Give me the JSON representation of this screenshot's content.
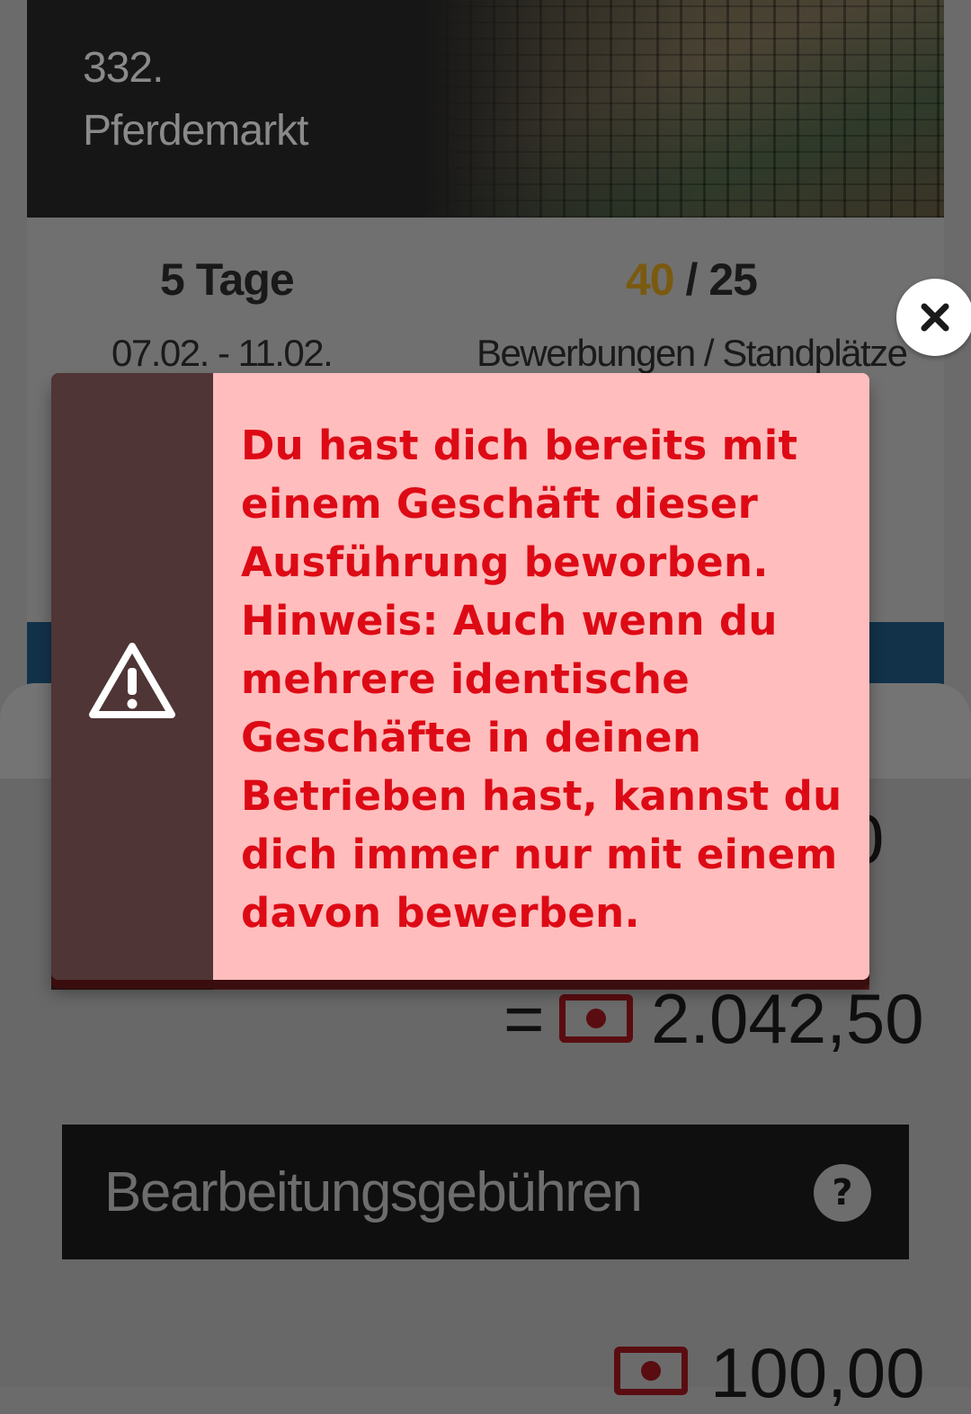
{
  "event": {
    "number": "332.",
    "name": "Pferdemarkt"
  },
  "stats": {
    "duration": "5 Tage",
    "dates": "07.02. - 11.02.",
    "applications": "40",
    "separator": "/",
    "spots": "25",
    "applications_label": "Bewerbungen / Standplätze"
  },
  "costs": {
    "partial_value": "0",
    "equals": "=",
    "total": "2.042,50",
    "fee_label": "Bearbeitungsgebühren",
    "fee_amount": "100,00",
    "currency_icon": "money-icon"
  },
  "alert": {
    "icon": "warning-icon",
    "message": "Du hast dich bereits mit einem Geschäft dieser Ausführung beworben. Hinweis: Auch wenn du mehrere identische Geschäfte in deinen Betrieben hast, kannst du dich immer nur mit einem davon bewerben.",
    "close_icon": "close-icon"
  },
  "colors": {
    "alert_bg": "#ffbdbd",
    "alert_text": "#dd0a15",
    "alert_side": "#4f3535",
    "accent": "#7a5a10"
  }
}
